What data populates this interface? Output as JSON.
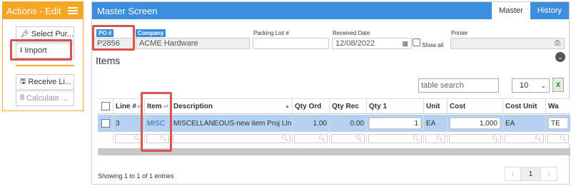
{
  "actions": {
    "title": "Actions - Edit",
    "buttons": [
      {
        "label": "Select Pur...",
        "icon": "pin-icon"
      },
      {
        "label": "Import",
        "icon": "download-icon"
      },
      {
        "label": "Receive Li...",
        "icon": "save-icon"
      },
      {
        "label": "Calculate ...",
        "icon": "calculator-icon"
      }
    ]
  },
  "main": {
    "title": "Master Screen",
    "tabs": [
      "Master",
      "History"
    ]
  },
  "form": {
    "po_label": "PO #",
    "po_value": "P2856",
    "company_label": "Company",
    "company_value": "ACME Hardware",
    "packing_label": "Packing List #",
    "packing_value": "",
    "received_label": "Received Date",
    "received_value": "12/08/2022",
    "show_all_label": "Show all",
    "printer_label": "Printer",
    "printer_value": ""
  },
  "items": {
    "title": "Items",
    "search_placeholder": "table search",
    "page_size": "10",
    "columns": [
      "Line #",
      "Item",
      "Description",
      "Qty Ord",
      "Qty Rec",
      "Qty 1",
      "Unit",
      "Cost",
      "Cost Unit",
      "Wa"
    ],
    "rows": [
      {
        "line": "3",
        "item": "MISC",
        "description": "MISCELLANEOUS-new item Proj LInked",
        "qty_ord": "1.00",
        "qty_rec": "0.00",
        "qty1": "1",
        "unit": "EA",
        "cost": "1,000",
        "cost_unit": "EA",
        "wa": "TE"
      }
    ],
    "info": "Showing 1 to 1 of 1 entries",
    "current_page": "1"
  },
  "colors": {
    "accent_orange": "#f5a623",
    "header_blue": "#3c8dde",
    "row_selected": "#b5d1f2",
    "highlight_red": "#d9534f"
  }
}
